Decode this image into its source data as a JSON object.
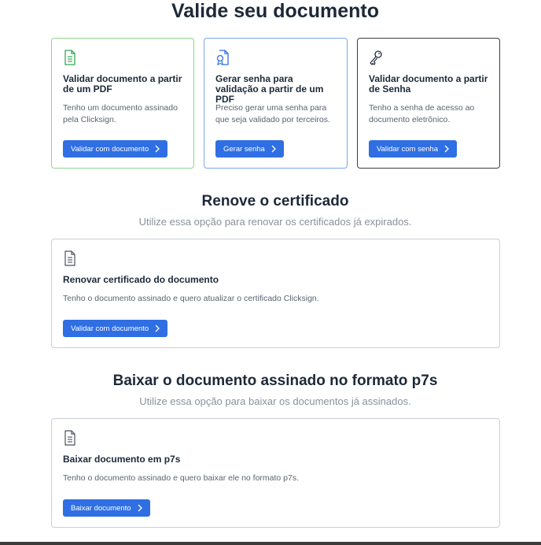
{
  "validate": {
    "title": "Valide seu documento",
    "cards": [
      {
        "icon": "document-icon",
        "title": "Validar documento a partir de um PDF",
        "description": "Tenho um documento assinado pela Clicksign.",
        "button": "Validar com documento",
        "border_color": "#7ed27e"
      },
      {
        "icon": "document-badge-icon",
        "title": "Gerar senha para validação a partir de um PDF",
        "description": "Preciso gerar uma senha para que seja validado por terceiros.",
        "button": "Gerar senha",
        "border_color": "#6d9cf0"
      },
      {
        "icon": "key-icon",
        "title": "Validar documento a partir de Senha",
        "description": "Tenho a senha de acesso ao documento eletrônico.",
        "button": "Validar com senha",
        "border_color": "#2b2f36"
      }
    ]
  },
  "renew": {
    "title": "Renove o certificado",
    "subtitle": "Utilize essa opção para renovar os certificados já expirados.",
    "card": {
      "icon": "document-icon",
      "title": "Renovar certificado do documento",
      "description": "Tenho o documento assinado e quero atualizar o certificado Clicksign.",
      "button": "Validar com documento"
    }
  },
  "download": {
    "title": "Baixar o documento assinado no formato p7s",
    "subtitle": "Utilize essa opção para baixar os documentos já assinados.",
    "card": {
      "icon": "document-icon",
      "title": "Baixar documento em p7s",
      "description": "Tenho o documento assinado e quero baixar ele no formato p7s.",
      "button": "Baixar documento"
    }
  },
  "colors": {
    "accent": "#2f6fe3"
  }
}
